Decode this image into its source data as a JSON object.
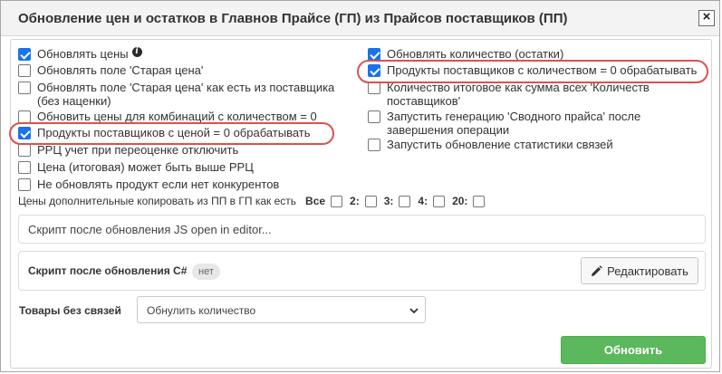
{
  "dialog": {
    "title": "Обновление цен и остатков в Главнов Прайсе (ГП) из Прайсов поставщиков (ПП)",
    "close_label": "×"
  },
  "left_options": [
    {
      "label": "Обновлять цены",
      "checked": true,
      "info": true
    },
    {
      "label": "Обновлять поле 'Старая цена'",
      "checked": false
    },
    {
      "label": "Обновлять поле 'Старая цена' как есть из поставщика",
      "label2": "(без наценки)",
      "checked": false
    },
    {
      "label": "Обновить цены для комбинаций с количеством = 0",
      "checked": false
    },
    {
      "label": "Продукты поставщиков с ценой = 0 обрабатывать",
      "checked": true
    },
    {
      "label": "РРЦ учет при переоценке отключить",
      "checked": false
    },
    {
      "label": "Цена (итоговая) может быть выше РРЦ",
      "checked": false
    },
    {
      "label": "Не обновлять продукт если нет конкурентов",
      "checked": false
    }
  ],
  "right_options": [
    {
      "label": "Обновлять количество (остатки)",
      "checked": true
    },
    {
      "label": "Продукты поставщиков с количеством = 0 обрабатывать",
      "checked": true
    },
    {
      "label": "Количество итоговое как сумма всех 'Количеств",
      "label2": "поставщиков'",
      "checked": false
    },
    {
      "label": "Запустить генерацию 'Сводного прайса' после",
      "label2": "завершения операции",
      "checked": false
    },
    {
      "label": "Запустить обновление статистики связей",
      "checked": false
    }
  ],
  "copy_prices": {
    "label": "Цены дополнительные копировать из ПП в ГП как есть",
    "options": [
      "Все",
      "2:",
      "3:",
      "4:",
      "20:"
    ]
  },
  "script_js": {
    "text": "Скрипт после обновления JS open in editor..."
  },
  "script_cs": {
    "label": "Скрипт после обновления C#",
    "badge": "нет",
    "edit_label": "Редактировать"
  },
  "no_links": {
    "label": "Товары без связей",
    "selected": "Обнулить количество"
  },
  "update_button": "Обновить",
  "colors": {
    "accent": "#1a73e8",
    "highlight": "#d9534f",
    "primary_button": "#5cb85c"
  }
}
